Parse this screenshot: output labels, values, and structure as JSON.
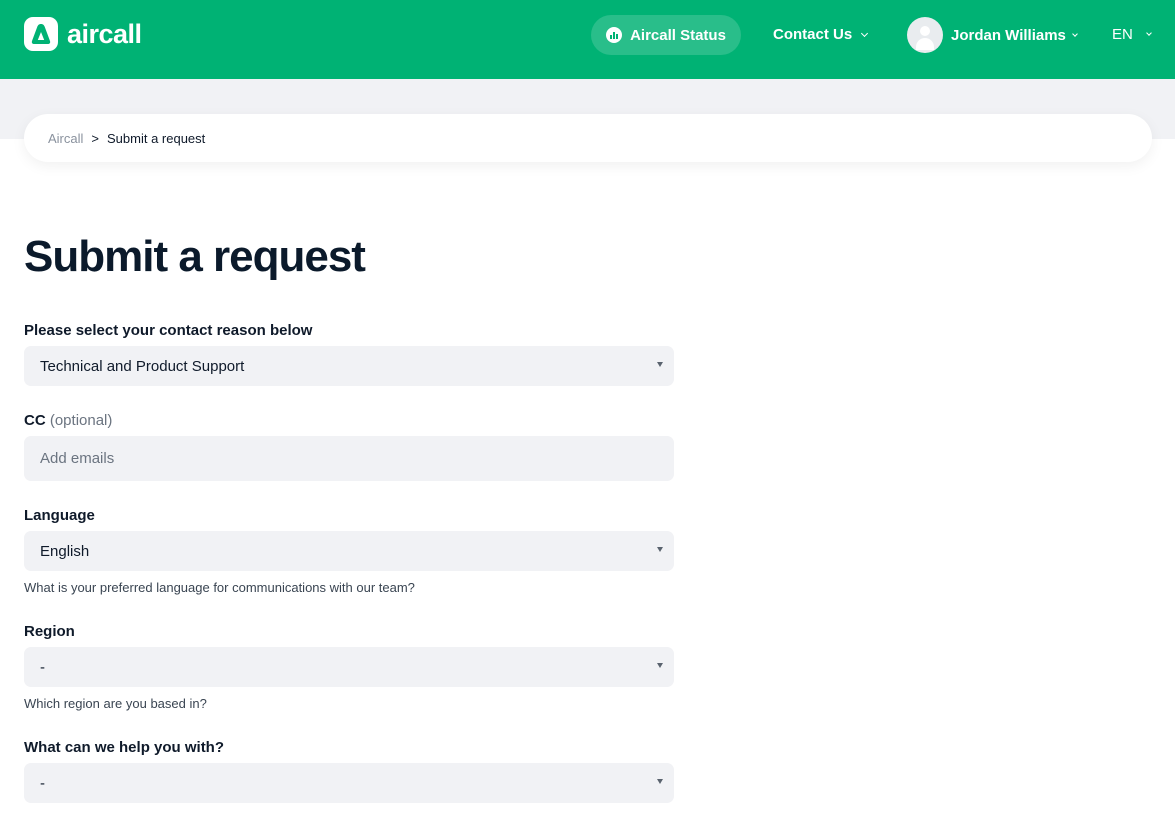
{
  "header": {
    "logo_text": "aircall",
    "status_label": "Aircall Status",
    "contact_label": "Contact Us",
    "user_name": "Jordan Williams",
    "language": "EN",
    "bg_color": "#00b274"
  },
  "breadcrumb": {
    "root": "Aircall",
    "separator": ">",
    "current": "Submit a request"
  },
  "page": {
    "title": "Submit a request"
  },
  "form": {
    "contact_reason": {
      "label": "Please select your contact reason below",
      "value": "Technical and Product Support"
    },
    "cc": {
      "label": "CC",
      "optional": "(optional)",
      "placeholder": "Add emails"
    },
    "language": {
      "label": "Language",
      "value": "English",
      "hint": "What is your preferred language for communications with our team?"
    },
    "region": {
      "label": "Region",
      "value": "-",
      "hint": "Which region are you based in?"
    },
    "help_with": {
      "label": "What can we help you with?",
      "value": "-"
    }
  }
}
